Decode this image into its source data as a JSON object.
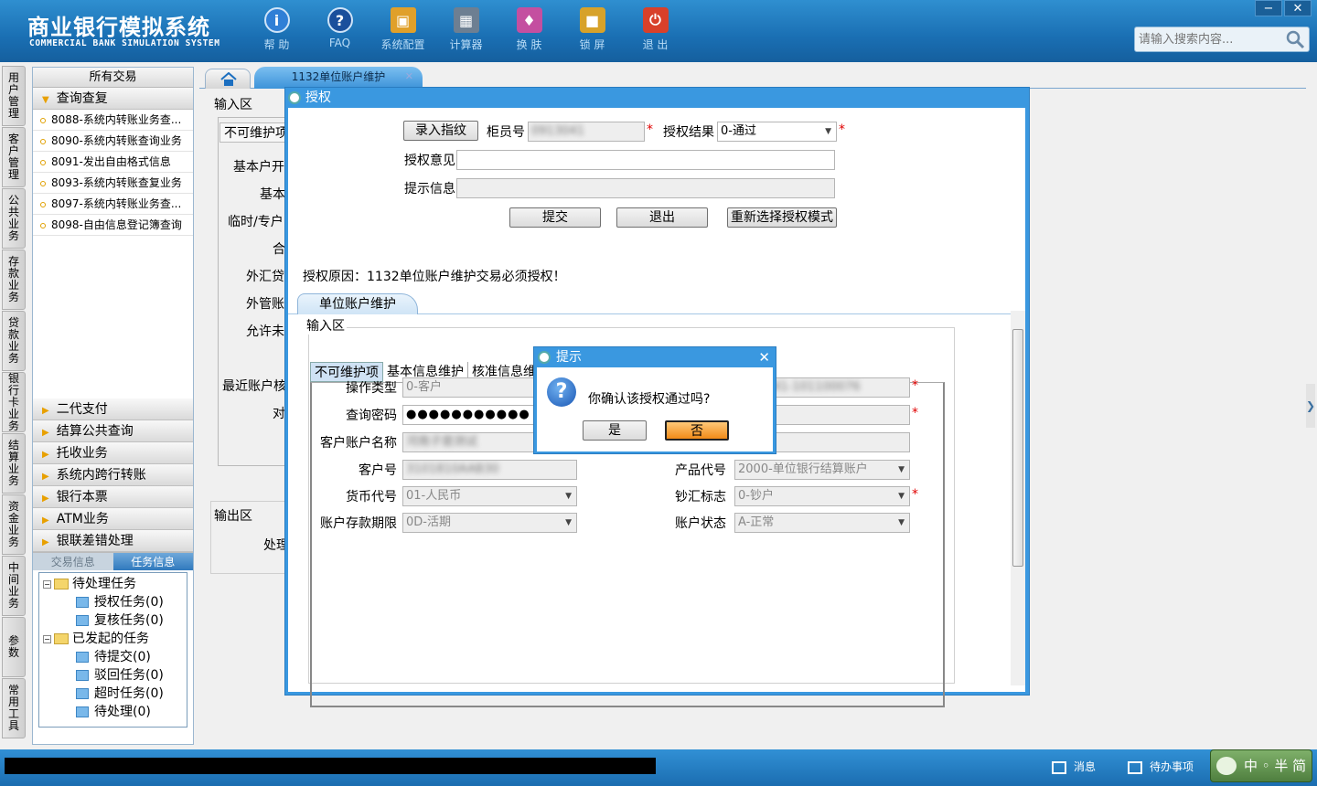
{
  "app": {
    "title_cn": "商业银行模拟系统",
    "title_en": "COMMERCIAL BANK SIMULATION SYSTEM"
  },
  "toolbar": [
    {
      "label": "帮 助",
      "icon": "info-icon",
      "color": "#2f7fd6"
    },
    {
      "label": "FAQ",
      "icon": "question-icon",
      "color": "#1a4f9c"
    },
    {
      "label": "系统配置",
      "icon": "toolbox-icon",
      "color": "#e0a02a"
    },
    {
      "label": "计算器",
      "icon": "calculator-icon",
      "color": "#6d7f92"
    },
    {
      "label": "换 肤",
      "icon": "shirt-icon",
      "color": "#c44fa0"
    },
    {
      "label": "锁 屏",
      "icon": "lock-icon",
      "color": "#d7a22a"
    },
    {
      "label": "退 出",
      "icon": "power-icon",
      "color": "#d8402a"
    }
  ],
  "window_controls": {
    "minimize": "−",
    "close": "✕"
  },
  "search": {
    "placeholder": "请输入搜索内容..."
  },
  "vstrip": [
    "用户管理",
    "客户管理",
    "公共业务",
    "存款业务",
    "贷款业务",
    "银行卡业务",
    "结算业务",
    "资金业务",
    "中间业务",
    "参数",
    "常用工具"
  ],
  "sidebar": {
    "header": "所有交易",
    "open_group": "查询查复",
    "items": [
      "8088-系统内转账业务查...",
      "8090-系统内转账查询业务",
      "8091-发出自由格式信息",
      "8093-系统内转账查复业务",
      "8097-系统内转账业务查...",
      "8098-自由信息登记簿查询"
    ],
    "groups": [
      "二代支付",
      "结算公共查询",
      "托收业务",
      "系统内跨行转账",
      "银行本票",
      "ATM业务",
      "银联差错处理"
    ],
    "tabs": [
      "交易信息",
      "任务信息"
    ],
    "tree": {
      "pending": "待处理任务",
      "pending_children": [
        "授权任务(0)",
        "复核任务(0)"
      ],
      "started": "已发起的任务",
      "started_children": [
        "待提交(0)",
        "驳回任务(0)",
        "超时任务(0)",
        "待处理(0)"
      ]
    }
  },
  "main_tabs": {
    "active": "1132单位账户维护",
    "close": "✕"
  },
  "background": {
    "input_area": "输入区",
    "tab": "不可维护项",
    "labels": [
      "基本户开",
      "基本",
      "临时/专户",
      "合",
      "外汇贷",
      "外管账",
      "允许未",
      "最近账户核",
      "对"
    ],
    "output_area": "输出区",
    "output_label": "处理"
  },
  "auth": {
    "title": "授权",
    "fingerprint_btn": "录入指纹",
    "teller_label": "柜员号",
    "teller_value": "0913041",
    "result_label": "授权结果",
    "result_value": "0-通过",
    "opinion_label": "授权意见",
    "hint_label": "提示信息",
    "submit": "提交",
    "exit": "退出",
    "reselect": "重新选择授权模式",
    "reason": "授权原因：1132单位账户维护交易必须授权！",
    "inner_tab": "单位账户维护",
    "input_area": "输入区",
    "sub_tabs": [
      "不可维护项",
      "基本信息维护",
      "核准信息维"
    ],
    "form": {
      "op_type_label": "操作类型",
      "op_type_value": "0-客户",
      "pwd_label": "查询密码",
      "pwd_value": "●●●●●●●●●●●",
      "name_label": "客户账户名称",
      "name_value": "河南子是测试",
      "cust_label": "客户号",
      "cust_value": "3101810AAB30",
      "right_top_value": "41-101100076",
      "currency_label": "货币代号",
      "currency_value": "01-人民币",
      "term_label": "账户存款期限",
      "term_value": "0D-活期",
      "product_label": "产品代号",
      "product_value": "2000-单位银行结算账户",
      "cash_label": "钞汇标志",
      "cash_value": "0-钞户",
      "status_label": "账户状态",
      "status_value": "A-正常"
    }
  },
  "dialog": {
    "title": "提示",
    "message": "你确认该授权通过吗?",
    "yes": "是",
    "no": "否",
    "close": "✕"
  },
  "statusbar": {
    "messages": "消息",
    "todos": "待办事项",
    "ime": "中 ◦ 半 简"
  }
}
